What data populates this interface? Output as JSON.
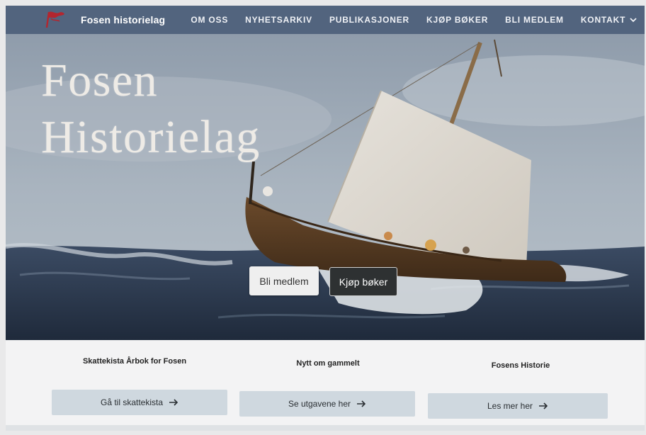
{
  "navbar": {
    "brand": "Fosen historielag",
    "links": [
      "OM OSS",
      "NYHETSARKIV",
      "PUBLIKASJONER",
      "KJØP BØKER",
      "BLI MEDLEM",
      "KONTAKT"
    ]
  },
  "hero": {
    "title_line1": "Fosen",
    "title_line2": "Historielag",
    "btn_member": "Bli medlem",
    "btn_buy": "Kjøp bøker"
  },
  "cards": [
    {
      "title": "Skattekista Årbok for Fosen",
      "button": "Gå til skattekista"
    },
    {
      "title": "Nytt om gammelt",
      "button": "Se utgavene her"
    },
    {
      "title": "Fosens Historie",
      "button": "Les mer her"
    }
  ],
  "icons": {
    "logo": "flag-logo-icon",
    "dropdown": "chevron-down-icon",
    "arrow": "arrow-right-icon"
  },
  "colors": {
    "navbar": "#52647e",
    "logo": "#b3262f",
    "card_button": "#cfd8df",
    "dark_button": "#2e3132"
  }
}
